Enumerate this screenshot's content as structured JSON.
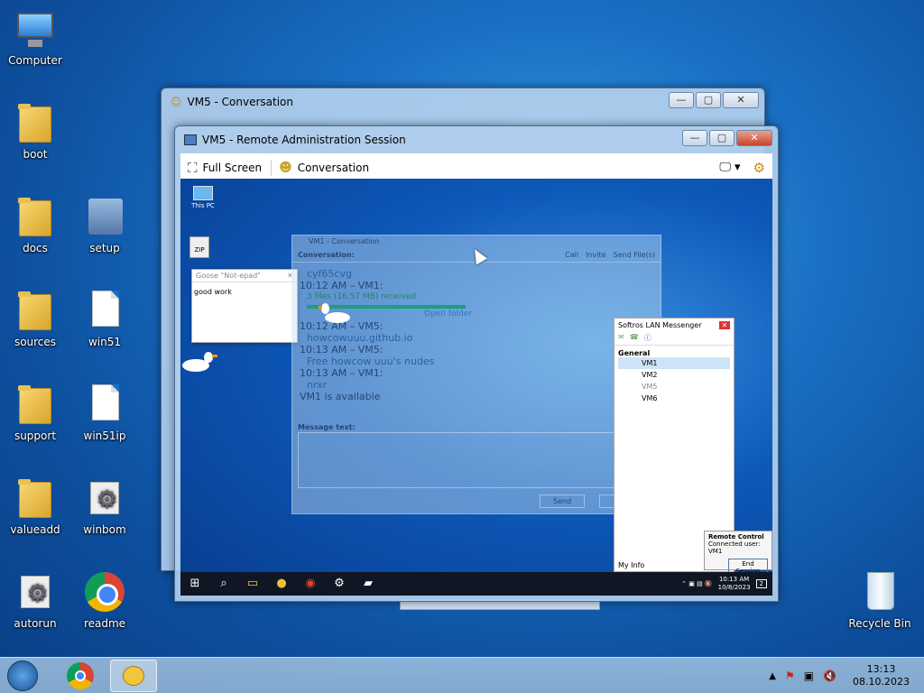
{
  "desktop_icons": [
    {
      "name": "computer",
      "label": "Computer"
    },
    {
      "name": "boot",
      "label": "boot"
    },
    {
      "name": "docs",
      "label": "docs"
    },
    {
      "name": "setup",
      "label": "setup"
    },
    {
      "name": "sources",
      "label": "sources"
    },
    {
      "name": "win51",
      "label": "win51"
    },
    {
      "name": "support",
      "label": "support"
    },
    {
      "name": "win51ip",
      "label": "win51ip"
    },
    {
      "name": "valueadd",
      "label": "valueadd"
    },
    {
      "name": "winbom",
      "label": "winbom"
    },
    {
      "name": "autorun",
      "label": "autorun"
    },
    {
      "name": "readme",
      "label": "readme"
    },
    {
      "name": "recycle-bin",
      "label": "Recycle Bin"
    }
  ],
  "back_window": {
    "title": "VM5 - Conversation"
  },
  "remote_window": {
    "title": "VM5 - Remote Administration Session",
    "toolbar": {
      "full_screen": "Full Screen",
      "conversation": "Conversation"
    }
  },
  "remote_desktop": {
    "icons": [
      {
        "label": "This PC"
      },
      {
        "label": "ZIP"
      }
    ],
    "goose_note": {
      "title": "Goose \"Not-epad\"",
      "text": "good work"
    },
    "conversation": {
      "title": "VM1 - Conversation",
      "toolbar": {
        "call": "Call",
        "invite": "Invite",
        "send_files": "Send File(s)"
      },
      "label": "Conversation:",
      "lines": [
        "cyf65cvg",
        "10:12 AM – VM1:",
        "3 files (16.57 MB) received",
        "Open folder",
        "10:12 AM – VM5:",
        "howcowuuu.github.io",
        "10:13 AM – VM5:",
        "Free howcow uuu's nudes",
        "10:13 AM – VM1:",
        "nrxr",
        "VM1 is available"
      ],
      "message_label": "Message text:",
      "send": "Send",
      "close": "Close"
    },
    "messenger": {
      "title": "Softros LAN Messenger",
      "group": "General",
      "users": [
        "VM1",
        "VM2",
        "VM5",
        "VM6"
      ],
      "my_info": "My Info"
    },
    "remote_control": {
      "title": "Remote Control",
      "connected": "Connected user: VM1",
      "end": "End Session"
    },
    "taskbar": {
      "time": "10:13 AM",
      "date": "10/8/2023",
      "notif": "2"
    }
  },
  "taskbar": {
    "time": "13:13",
    "date": "08.10.2023"
  }
}
